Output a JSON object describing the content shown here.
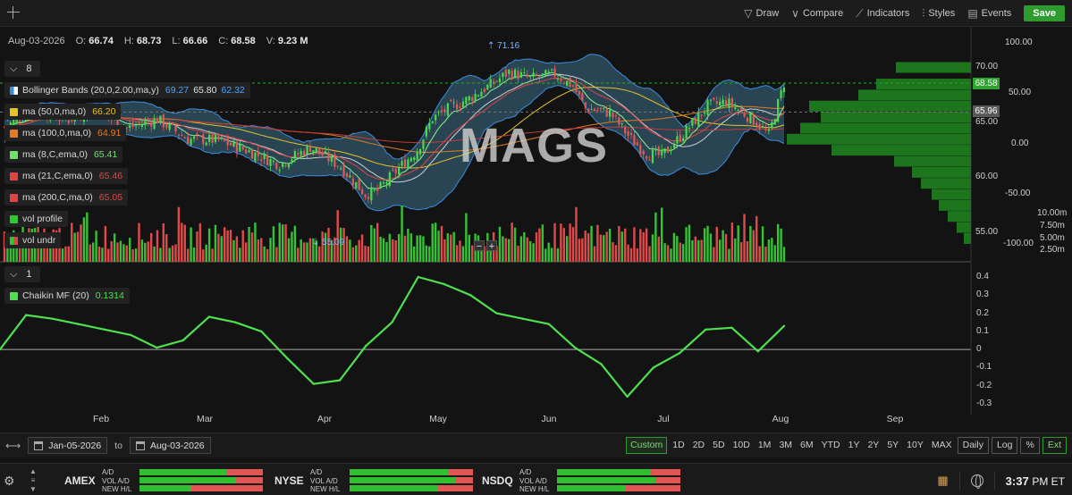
{
  "toolbar": {
    "draw_label": "Draw",
    "compare_label": "Compare",
    "indicators_label": "Indicators",
    "styles_label": "Styles",
    "events_label": "Events",
    "save_label": "Save"
  },
  "ohlc": {
    "date": "Aug-03-2026",
    "open_label": "O:",
    "open": "66.74",
    "high_label": "H:",
    "high": "68.73",
    "low_label": "L:",
    "low": "66.66",
    "close_label": "C:",
    "close": "68.58",
    "volume_label": "V:",
    "volume": "9.23 M"
  },
  "main_pane": {
    "collapse_count": "8",
    "watermark": "MAGS",
    "high_annotation": "71.16",
    "low_annotation": "55.09",
    "zoom_minus": "−",
    "zoom_plus": "+",
    "last_price_tag": "68.58",
    "ref_price_tag": "65.96",
    "price_ticks": [
      "70.00",
      "65.00",
      "60.00",
      "55.00"
    ],
    "cmf_ticks": [
      "100.00",
      "50.00",
      "0.00",
      "-50.00",
      "-100.00"
    ],
    "volume_ticks": [
      "10.00m",
      "7.50m",
      "5.00m",
      "2.50m"
    ],
    "indicators": [
      {
        "name": "Bollinger Bands (20,0,2.00,ma,y)",
        "color": "#3a8dde",
        "v1": "69.27",
        "v2": "65.80",
        "v3": "62.32"
      },
      {
        "name": "ma (50,0,ma,0)",
        "color": "#e6c229",
        "v1": "66.20"
      },
      {
        "name": "ma (100,0,ma,0)",
        "color": "#e37b22",
        "v1": "64.91"
      },
      {
        "name": "ma (8,C,ema,0)",
        "color": "#6be26b",
        "v1": "65.41"
      },
      {
        "name": "ma (21,C,ema,0)",
        "color": "#e04444",
        "v1": "65.46"
      },
      {
        "name": "ma (200,C,ma,0)",
        "color": "#e04444",
        "v1": "65.05"
      },
      {
        "name": "vol profile",
        "color": "#2ec92e"
      },
      {
        "name": "vol undr",
        "color": "split"
      }
    ]
  },
  "osc_pane": {
    "collapse_count": "1",
    "indicator_name": "Chaikin MF (20)",
    "indicator_value": "0.1314",
    "indicator_color": "#4ee04e",
    "ticks": [
      "0.4",
      "0.3",
      "0.2",
      "0.1",
      "0",
      "-0.1",
      "-0.2",
      "-0.3"
    ]
  },
  "chart_data": {
    "type": "line",
    "title": "",
    "series": [
      {
        "name": "Chaikin MF (20)",
        "x": [
          "Jan-05",
          "Jan-12",
          "Jan-19",
          "Jan-26",
          "Feb-02",
          "Feb-09",
          "Feb-16",
          "Feb-23",
          "Mar-02",
          "Mar-09",
          "Mar-16",
          "Mar-23",
          "Mar-30",
          "Apr-06",
          "Apr-13",
          "Apr-20",
          "Apr-27",
          "May-04",
          "May-11",
          "May-18",
          "May-25",
          "Jun-01",
          "Jun-08",
          "Jun-15",
          "Jun-22",
          "Jun-29",
          "Jul-06",
          "Jul-13",
          "Jul-20",
          "Jul-27",
          "Aug-03"
        ],
        "values": [
          0.0,
          0.19,
          0.17,
          0.14,
          0.11,
          0.08,
          0.01,
          0.05,
          0.18,
          0.15,
          0.1,
          -0.05,
          -0.19,
          -0.17,
          0.02,
          0.15,
          0.4,
          0.36,
          0.3,
          0.2,
          0.17,
          0.14,
          0.01,
          -0.08,
          -0.26,
          -0.1,
          -0.02,
          0.11,
          0.12,
          -0.01,
          0.13
        ]
      }
    ],
    "ylim": [
      -0.3,
      0.4
    ],
    "grid": false
  },
  "x_axis": {
    "months": [
      "Feb",
      "Mar",
      "Apr",
      "May",
      "Jun",
      "Jul",
      "Aug",
      "Sep"
    ]
  },
  "range": {
    "start_date": "Jan-05-2026",
    "to_label": "to",
    "end_date": "Aug-03-2026",
    "periods": [
      "Custom",
      "1D",
      "2D",
      "5D",
      "10D",
      "1M",
      "3M",
      "6M",
      "YTD",
      "1Y",
      "2Y",
      "5Y",
      "10Y",
      "MAX"
    ],
    "active_period": "Custom",
    "interval": "Daily",
    "scale_log": "Log",
    "scale_pct": "%",
    "ext_label": "Ext"
  },
  "status": {
    "markets": [
      {
        "name": "AMEX",
        "lbl1": "A/D",
        "lbl2": "VOL A/D",
        "lbl3": "NEW H/L",
        "bars": [
          0.7,
          0.78,
          0.42
        ]
      },
      {
        "name": "NYSE",
        "lbl1": "A/D",
        "lbl2": "VOL A/D",
        "lbl3": "NEW H/L",
        "bars": [
          0.8,
          0.86,
          0.72
        ]
      },
      {
        "name": "NSDQ",
        "lbl1": "A/D",
        "lbl2": "VOL A/D",
        "lbl3": "NEW H/L",
        "bars": [
          0.75,
          0.8,
          0.56
        ]
      }
    ],
    "time": "3:37",
    "time_suffix": "PM ET"
  },
  "colors": {
    "up": "#36c236",
    "down": "#e04a4a",
    "bollinger_fill": "#3d6f88",
    "profile": "#1e7a1e"
  }
}
